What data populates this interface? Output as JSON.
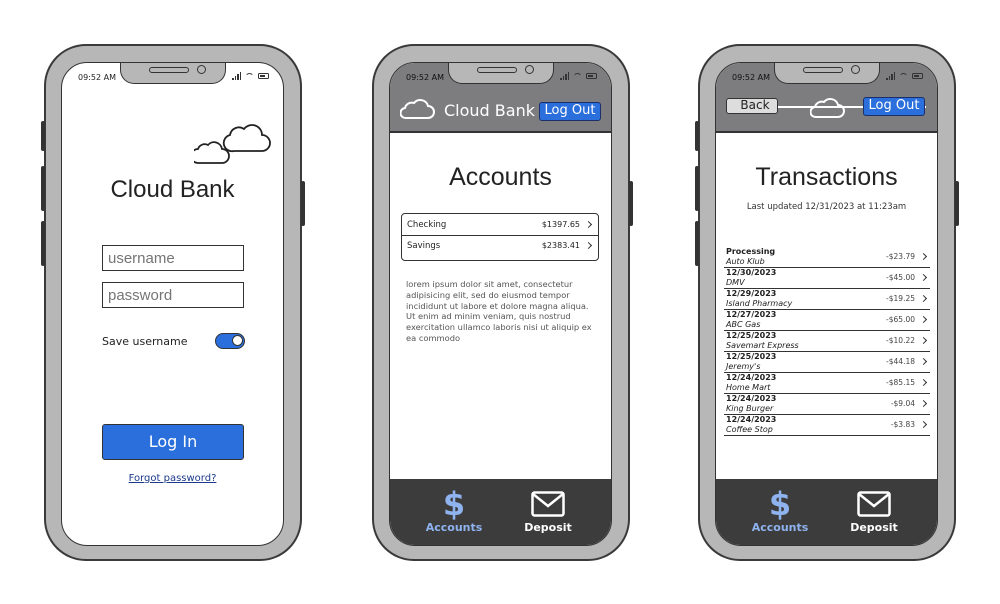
{
  "status": {
    "time": "09:52 AM"
  },
  "login": {
    "title": "Cloud Bank",
    "username_placeholder": "username",
    "password_placeholder": "password",
    "save_username_label": "Save username",
    "save_username_on": true,
    "login_button": "Log In",
    "forgot_link": "Forgot password?"
  },
  "accounts": {
    "app_title": "Cloud Bank",
    "logout": "Log Out",
    "heading": "Accounts",
    "items": [
      {
        "name": "Checking",
        "balance": "$1397.65"
      },
      {
        "name": "Savings",
        "balance": "$2383.41"
      }
    ],
    "body_text": "lorem ipsum dolor sit amet, consectetur adipisicing elit, sed do eiusmod tempor incididunt ut labore et dolore magna aliqua. Ut enim ad minim veniam, quis nostrud exercitation ullamco laboris nisi ut aliquip ex ea commodo"
  },
  "transactions": {
    "back": "Back",
    "logout": "Log Out",
    "heading": "Transactions",
    "updated": "Last updated 12/31/2023 at 11:23am",
    "items": [
      {
        "date": "Processing",
        "merchant": "Auto Klub",
        "amount": "-$23.79"
      },
      {
        "date": "12/30/2023",
        "merchant": "DMV",
        "amount": "-$45.00"
      },
      {
        "date": "12/29/2023",
        "merchant": "Island Pharmacy",
        "amount": "-$19.25"
      },
      {
        "date": "12/27/2023",
        "merchant": "ABC Gas",
        "amount": "-$65.00"
      },
      {
        "date": "12/25/2023",
        "merchant": "Savemart Express",
        "amount": "-$10.22"
      },
      {
        "date": "12/25/2023",
        "merchant": "Jeremy's",
        "amount": "-$44.18"
      },
      {
        "date": "12/24/2023",
        "merchant": "Home Mart",
        "amount": "-$85.15"
      },
      {
        "date": "12/24/2023",
        "merchant": "King Burger",
        "amount": "-$9.04"
      },
      {
        "date": "12/24/2023",
        "merchant": "Coffee Stop",
        "amount": "-$3.83"
      }
    ]
  },
  "tabs": {
    "accounts": "Accounts",
    "deposit": "Deposit",
    "active_color": "#8fb3ee",
    "inactive_color": "#ffffff"
  },
  "icons": {
    "cloud": "cloud-icon",
    "dollar": "dollar-icon",
    "envelope": "envelope-icon"
  }
}
